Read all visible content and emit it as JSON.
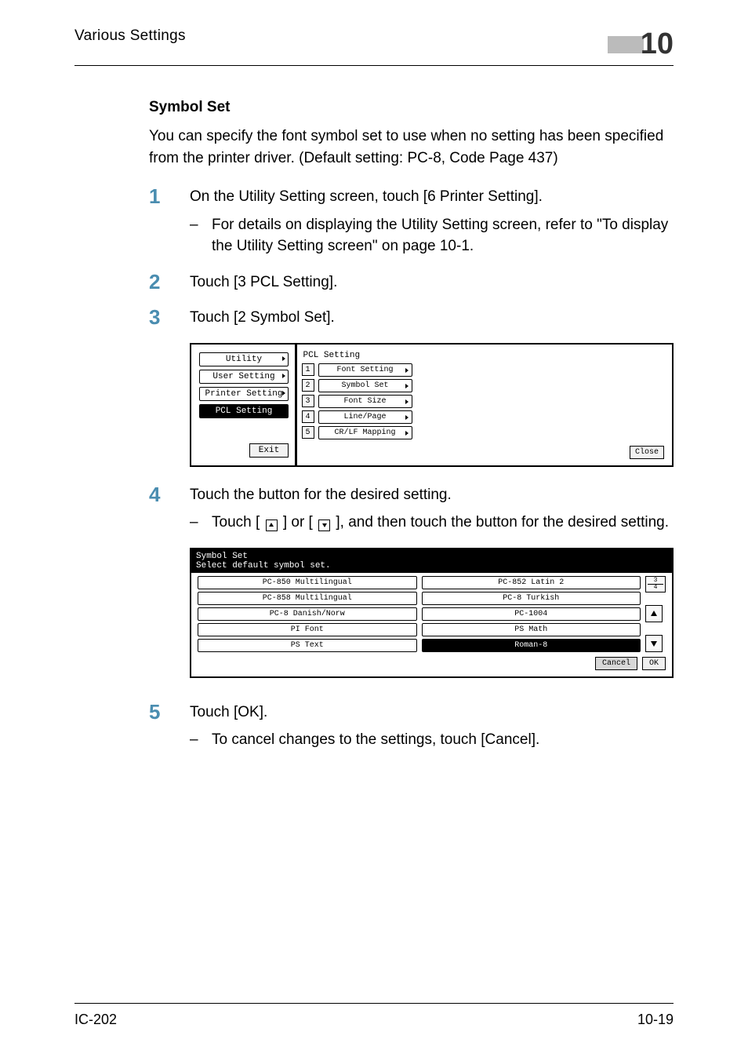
{
  "header": {
    "title": "Various Settings",
    "chapter": "10"
  },
  "section": {
    "title": "Symbol Set",
    "intro": "You can specify the font symbol set to use when no setting has been specified from the printer driver. (Default setting: PC-8, Code Page 437)"
  },
  "steps": {
    "s1": {
      "text": "On the Utility Setting screen, touch [6 Printer Setting].",
      "sub": "For details on displaying the Utility Setting screen, refer to \"To display the Utility Setting screen\" on page 10-1."
    },
    "s2": {
      "text": "Touch [3 PCL Setting]."
    },
    "s3": {
      "text": "Touch [2 Symbol Set]."
    },
    "s4": {
      "text": "Touch the button for the desired setting.",
      "sub_before": "Touch [ ",
      "sub_mid": " ] or [ ",
      "sub_after": " ], and then touch the button for the desired setting."
    },
    "s5": {
      "text": "Touch [OK].",
      "sub": "To cancel changes to the settings, touch [Cancel]."
    }
  },
  "panel1": {
    "crumbs": [
      "Utility",
      "User Setting",
      "Printer Setting",
      "PCL Setting"
    ],
    "exit": "Exit",
    "title": "PCL Setting",
    "items": [
      "Font Setting",
      "Symbol Set",
      "Font Size",
      "Line/Page",
      "CR/LF Mapping"
    ],
    "close": "Close"
  },
  "panel2": {
    "title": "Symbol Set",
    "subtitle": "Select default symbol set.",
    "options": [
      "PC-850 Multilingual",
      "PC-852 Latin 2",
      "PC-858 Multilingual",
      "PC-8 Turkish",
      "PC-8 Danish/Norw",
      "PC-1004",
      "PI Font",
      "PS Math",
      "PS Text",
      "Roman-8"
    ],
    "selected": "Roman-8",
    "page_num": "3",
    "page_total": "4",
    "cancel": "Cancel",
    "ok": "OK"
  },
  "footer": {
    "left": "IC-202",
    "right": "10-19"
  }
}
